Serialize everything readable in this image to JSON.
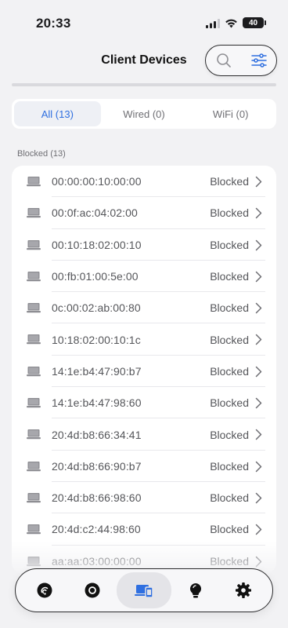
{
  "status_bar": {
    "time": "20:33",
    "battery": "40"
  },
  "header": {
    "title": "Client Devices"
  },
  "segments": [
    {
      "label": "All (13)",
      "active": true
    },
    {
      "label": "Wired (0)",
      "active": false
    },
    {
      "label": "WiFi (0)",
      "active": false
    }
  ],
  "section": {
    "label": "Blocked (13)"
  },
  "devices": [
    {
      "mac": "00:00:00:10:00:00",
      "status": "Blocked"
    },
    {
      "mac": "00:0f:ac:04:02:00",
      "status": "Blocked"
    },
    {
      "mac": "00:10:18:02:00:10",
      "status": "Blocked"
    },
    {
      "mac": "00:fb:01:00:5e:00",
      "status": "Blocked"
    },
    {
      "mac": "0c:00:02:ab:00:80",
      "status": "Blocked"
    },
    {
      "mac": "10:18:02:00:10:1c",
      "status": "Blocked"
    },
    {
      "mac": "14:1e:b4:47:90:b7",
      "status": "Blocked"
    },
    {
      "mac": "14:1e:b4:47:98:60",
      "status": "Blocked"
    },
    {
      "mac": "20:4d:b8:66:34:41",
      "status": "Blocked"
    },
    {
      "mac": "20:4d:b8:66:90:b7",
      "status": "Blocked"
    },
    {
      "mac": "20:4d:b8:66:98:60",
      "status": "Blocked"
    },
    {
      "mac": "20:4d:c2:44:98:60",
      "status": "Blocked"
    },
    {
      "mac": "aa:aa:03:00:00:00",
      "status": "Blocked"
    }
  ],
  "tab_bar": {
    "tabs": [
      {
        "icon": "router-icon",
        "active": false
      },
      {
        "icon": "circle-icon",
        "active": false
      },
      {
        "icon": "devices-icon",
        "active": true
      },
      {
        "icon": "lightbulb-icon",
        "active": false
      },
      {
        "icon": "gear-icon",
        "active": false
      }
    ]
  },
  "colors": {
    "accent": "#2f6fe0",
    "background": "#f2f2f4",
    "text_secondary": "#55565a"
  }
}
